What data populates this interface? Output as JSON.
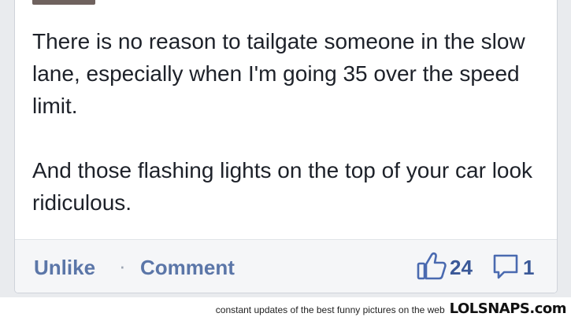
{
  "post": {
    "paragraphs": [
      "There is no reason to tailgate someone in the slow lane, especially when I'm going 35 over the speed limit.",
      "And those flashing lights on the top of your car look ridiculous."
    ]
  },
  "actions": {
    "unlike_label": "Unlike",
    "separator": "·",
    "comment_label": "Comment"
  },
  "stats": {
    "likes_count": "24",
    "comments_count": "1",
    "like_icon": "thumbs-up-icon",
    "comment_icon": "speech-bubble-icon"
  },
  "watermark": {
    "tagline": "constant updates of the best funny pictures on the web",
    "brand": "LOLSNAPS.com"
  },
  "colors": {
    "link_blue": "#5b76a8",
    "count_blue": "#3b5998",
    "text": "#1d2129"
  }
}
